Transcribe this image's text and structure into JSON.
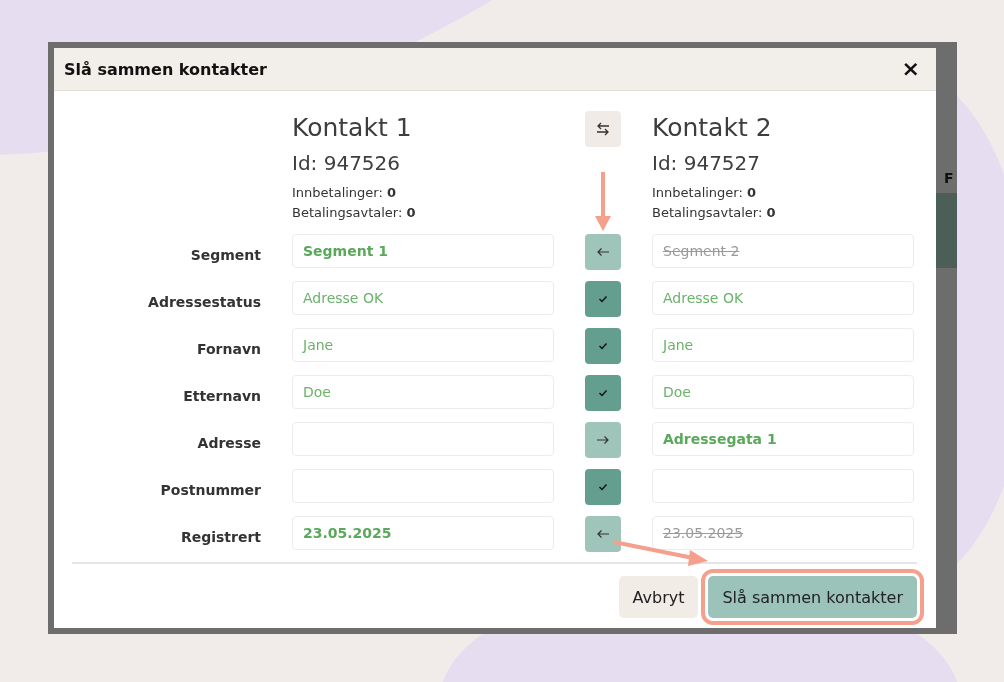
{
  "background": {
    "column_header": "F"
  },
  "dialog": {
    "title": "Slå sammen kontakter",
    "close_label": "×"
  },
  "contacts": [
    {
      "heading": "Kontakt 1",
      "id_label": "Id: 947526",
      "payments": "Innbetalinger: **0**",
      "agreements": "Betalingsavtaler: **0**"
    },
    {
      "heading": "Kontakt 2",
      "id_label": "Id: 947527",
      "payments": "Innbetalinger: **0**",
      "agreements": "Betalingsavtaler: **0**"
    }
  ],
  "fields": [
    {
      "label": "Segment",
      "kind": "left",
      "left": {
        "value": "Segment 1",
        "kind": "chosen"
      },
      "right": {
        "value": "Segment 2",
        "kind": "discarded"
      }
    },
    {
      "label": "Adressestatus",
      "kind": "equal",
      "left": {
        "value": "Adresse OK",
        "kind": "same"
      },
      "right": {
        "value": "Adresse OK",
        "kind": "same"
      }
    },
    {
      "label": "Fornavn",
      "kind": "equal",
      "left": {
        "value": "Jane",
        "kind": "same"
      },
      "right": {
        "value": "Jane",
        "kind": "same"
      }
    },
    {
      "label": "Etternavn",
      "kind": "equal",
      "left": {
        "value": "Doe",
        "kind": "same"
      },
      "right": {
        "value": "Doe",
        "kind": "same"
      }
    },
    {
      "label": "Adresse",
      "kind": "right",
      "right": {
        "value": "Adressegata 1",
        "kind": "chosen"
      }
    },
    {
      "label": "Postnummer",
      "kind": "equal"
    },
    {
      "label": "Registrert",
      "kind": "left",
      "left": {
        "value": "23.05.2025",
        "kind": "chosen"
      },
      "right": {
        "value": "23.05.2025",
        "kind": "discarded"
      }
    }
  ],
  "buttons": [
    {
      "label": "Avbryt",
      "kind": "secondary",
      "highlighted": false
    },
    {
      "label": "Slå sammen kontakter",
      "kind": "primary",
      "highlighted": true
    }
  ]
}
